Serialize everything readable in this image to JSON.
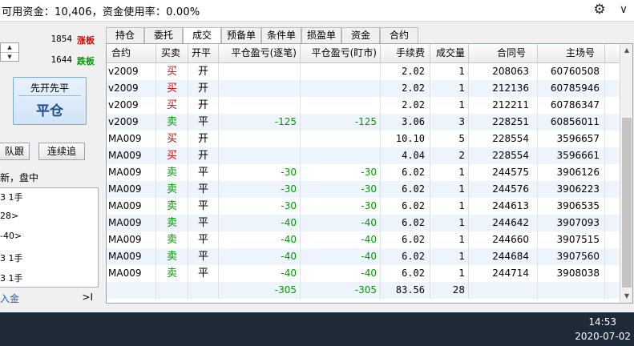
{
  "account_bar": {
    "text": "可用资金：10,406，资金使用率：0.00%",
    "icons": [
      "gear-icon",
      "chevron-down-icon"
    ]
  },
  "left_panel": {
    "quotes": [
      {
        "value": "1854",
        "tag": "涨板",
        "tag_color": "#e00000"
      },
      {
        "value": "1644",
        "tag": "跌板",
        "tag_color": "#009b00"
      }
    ],
    "spinner_icons": [
      "spin-up-icon",
      "spin-down-icon"
    ],
    "big_button": {
      "top": "先开先平",
      "bottom": "平仓"
    },
    "btn_follow": "队跟",
    "btn_continuous": "连续追",
    "status_line": "新，盘中",
    "log_items": [
      "3 1手",
      "28>",
      "-40>",
      "3 1手",
      "3 1手"
    ],
    "footer_link": "入金",
    "footer_toggle": ">I"
  },
  "tabs": [
    {
      "label": "持仓",
      "active": false
    },
    {
      "label": "委托",
      "active": false
    },
    {
      "label": "成交",
      "active": true
    },
    {
      "label": "预备单",
      "active": false
    },
    {
      "label": "条件单",
      "active": false
    },
    {
      "label": "损盈单",
      "active": false
    },
    {
      "label": "资金",
      "active": false
    },
    {
      "label": "合约",
      "active": false
    }
  ],
  "table": {
    "columns": [
      "合约",
      "买卖",
      "开平",
      "平仓盈亏(逐笔)",
      "平仓盈亏(盯市)",
      "手续费",
      "成交量",
      "合同号",
      "主场号"
    ],
    "rows": [
      [
        "v2009",
        "买",
        "开",
        "",
        "",
        "2.02",
        "1",
        "208063",
        "60760508"
      ],
      [
        "v2009",
        "买",
        "开",
        "",
        "",
        "2.02",
        "1",
        "212136",
        "60785946"
      ],
      [
        "v2009",
        "买",
        "开",
        "",
        "",
        "2.02",
        "1",
        "212211",
        "60786347"
      ],
      [
        "v2009",
        "卖",
        "平",
        "-125",
        "-125",
        "3.06",
        "3",
        "228251",
        "60856011"
      ],
      [
        "MA009",
        "买",
        "开",
        "",
        "",
        "10.10",
        "5",
        "228554",
        "3596657"
      ],
      [
        "MA009",
        "买",
        "开",
        "",
        "",
        "4.04",
        "2",
        "228554",
        "3596661"
      ],
      [
        "MA009",
        "卖",
        "平",
        "-30",
        "-30",
        "6.02",
        "1",
        "244575",
        "3906126"
      ],
      [
        "MA009",
        "卖",
        "平",
        "-30",
        "-30",
        "6.02",
        "1",
        "244576",
        "3906223"
      ],
      [
        "MA009",
        "卖",
        "平",
        "-30",
        "-30",
        "6.02",
        "1",
        "244613",
        "3906535"
      ],
      [
        "MA009",
        "卖",
        "平",
        "-40",
        "-40",
        "6.02",
        "1",
        "244642",
        "3907093"
      ],
      [
        "MA009",
        "卖",
        "平",
        "-40",
        "-40",
        "6.02",
        "1",
        "244660",
        "3907515"
      ],
      [
        "MA009",
        "卖",
        "平",
        "-40",
        "-40",
        "6.02",
        "1",
        "244684",
        "3907560"
      ],
      [
        "MA009",
        "卖",
        "平",
        "-40",
        "-40",
        "6.02",
        "1",
        "244714",
        "3908038"
      ]
    ],
    "totals": [
      "",
      "",
      "",
      "-305",
      "-305",
      "83.56",
      "28",
      "",
      ""
    ]
  },
  "colors": {
    "buy": "#e00000",
    "sell": "#009b00",
    "profit_negative": "#009b00"
  },
  "taskbar": {
    "time": "14:53",
    "date": "2020-07-02"
  }
}
